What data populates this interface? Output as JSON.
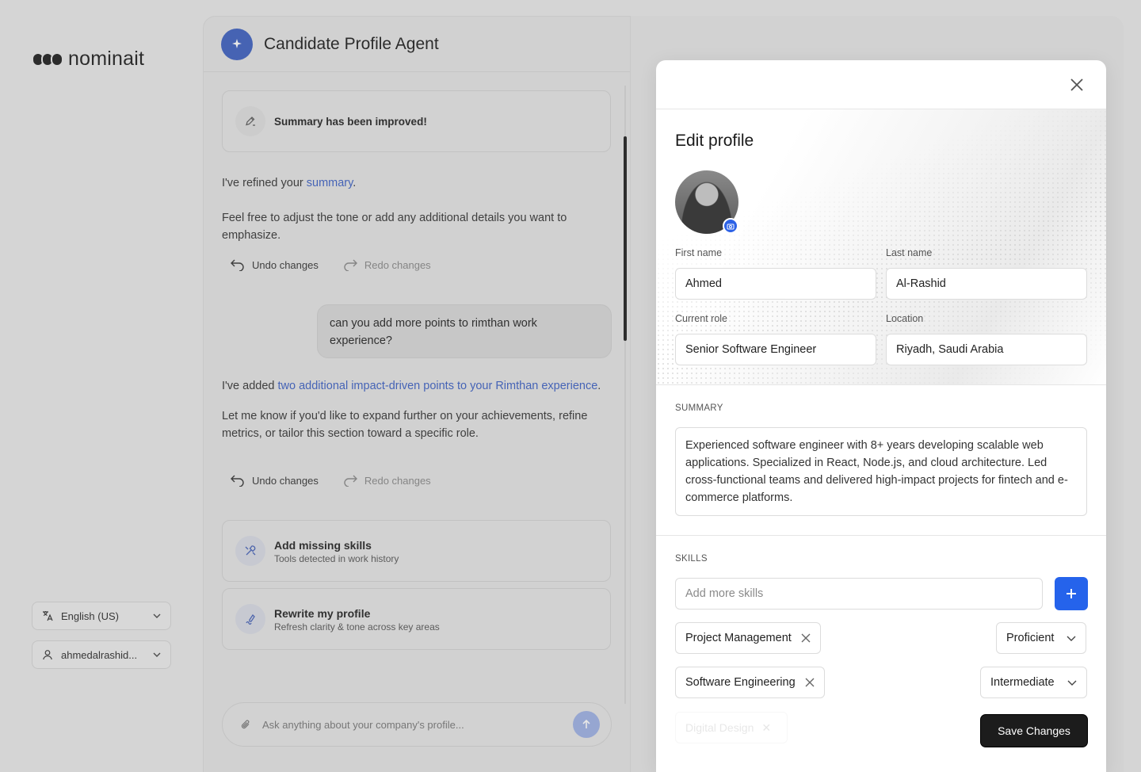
{
  "brand": {
    "name": "nominait"
  },
  "sidebar": {
    "language": {
      "label": "English (US)",
      "icon": "translate-icon"
    },
    "user": {
      "label": "ahmedalrashid...",
      "icon": "user-icon"
    }
  },
  "chat": {
    "title": "Candidate Profile Agent",
    "status_card": {
      "text": "Summary has been improved!",
      "icon": "edit-sparkle-icon"
    },
    "messages": [
      {
        "role": "agent",
        "before": "I've refined your ",
        "link": "summary",
        "after": ".",
        "follow": "Feel free to adjust the tone or add any additional details you want to emphasize."
      },
      {
        "role": "user",
        "text": "can you add more points to rimthan work experience?"
      },
      {
        "role": "agent",
        "before": "I've added ",
        "link": "two additional impact-driven points to your Rimthan experience",
        "after": ".",
        "follow": "Let me know if you'd like to expand further on your achievements, refine metrics, or tailor this section toward a specific role."
      }
    ],
    "undo_label": "Undo changes",
    "redo_label": "Redo changes",
    "suggestions": [
      {
        "title": "Add missing skills",
        "subtitle": "Tools detected in work history",
        "icon": "tools-icon"
      },
      {
        "title": "Rewrite my profile",
        "subtitle": "Refresh clarity & tone across key areas",
        "icon": "rewrite-icon"
      }
    ],
    "input_placeholder": "Ask anything about your company's profile..."
  },
  "modal": {
    "title": "Edit profile",
    "fields": {
      "first_name": {
        "label": "First name",
        "value": "Ahmed"
      },
      "last_name": {
        "label": "Last name",
        "value": "Al-Rashid"
      },
      "current_role": {
        "label": "Current role",
        "value": "Senior Software Engineer"
      },
      "location": {
        "label": "Location",
        "value": "Riyadh, Saudi Arabia"
      }
    },
    "summary": {
      "label": "SUMMARY",
      "text": "Experienced software engineer with 8+ years developing scalable web applications. Specialized in React, Node.js, and cloud architecture. Led cross-functional teams and delivered high-impact projects for fintech and e-commerce platforms."
    },
    "skills": {
      "label": "SKILLS",
      "placeholder": "Add more skills",
      "items": [
        {
          "name": "Project Management",
          "level": "Proficient"
        },
        {
          "name": "Software Engineering",
          "level": "Intermediate"
        },
        {
          "name": "Digital Design",
          "level": ""
        }
      ]
    },
    "save_label": "Save Changes"
  },
  "colors": {
    "accent": "#2563eb",
    "link": "#3a5fc4",
    "save": "#1c1c1c"
  }
}
